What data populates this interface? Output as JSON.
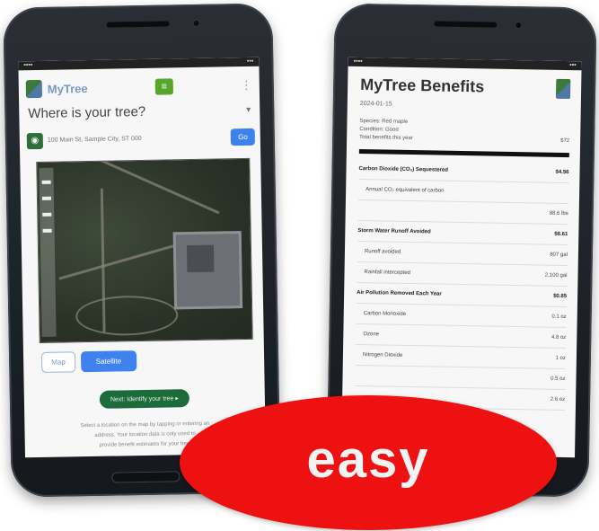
{
  "left_screen": {
    "app_name": "MyTree",
    "nav_badge": "≡",
    "menu_icon": "⋮",
    "question": "Where is your tree?",
    "address_placeholder": "100 Main St, Sample City, ST 000",
    "go_label": "Go",
    "toggle_map": "Map",
    "toggle_satellite": "Satellite",
    "submit_label": "Next: Identify your tree ▸",
    "footer_lines": [
      "Select a location on the map by tapping or entering an",
      "address. Your location data is only used to",
      "provide benefit estimates for your tree."
    ]
  },
  "right_screen": {
    "title": "MyTree Benefits",
    "date": "2024-01-15",
    "meta": [
      {
        "label": "Species: Red maple",
        "value": ""
      },
      {
        "label": "Condition: Good",
        "value": ""
      },
      {
        "label": "Total benefits this year",
        "value": "$72"
      }
    ],
    "lines": [
      {
        "label": "Carbon Dioxide (CO₂) Sequestered",
        "value": "$4.56",
        "style": "bold"
      },
      {
        "label": "Annual CO₂ equivalent of carbon",
        "value": "",
        "style": "indent"
      },
      {
        "label": "",
        "value": "88.6 lbs",
        "style": "right"
      },
      {
        "label": "Storm Water Runoff Avoided",
        "value": "$8.61",
        "style": "bold"
      },
      {
        "label": "Runoff avoided",
        "value": "807 gal",
        "style": "indent"
      },
      {
        "label": "Rainfall intercepted",
        "value": "2,100 gal",
        "style": "indent"
      },
      {
        "label": "Air Pollution Removed Each Year",
        "value": "$0.85",
        "style": "bold"
      },
      {
        "label": "Carbon Monoxide",
        "value": "0.1 oz",
        "style": "indent"
      },
      {
        "label": "Ozone",
        "value": "4.8 oz",
        "style": "indent"
      },
      {
        "label": "Nitrogen Dioxide",
        "value": "1 oz",
        "style": "indent"
      },
      {
        "label": "",
        "value": "0.5 oz",
        "style": "right"
      },
      {
        "label": "",
        "value": "2.6 oz",
        "style": "right"
      }
    ]
  },
  "badge": {
    "text": "easy",
    "color": "#ee1111"
  }
}
